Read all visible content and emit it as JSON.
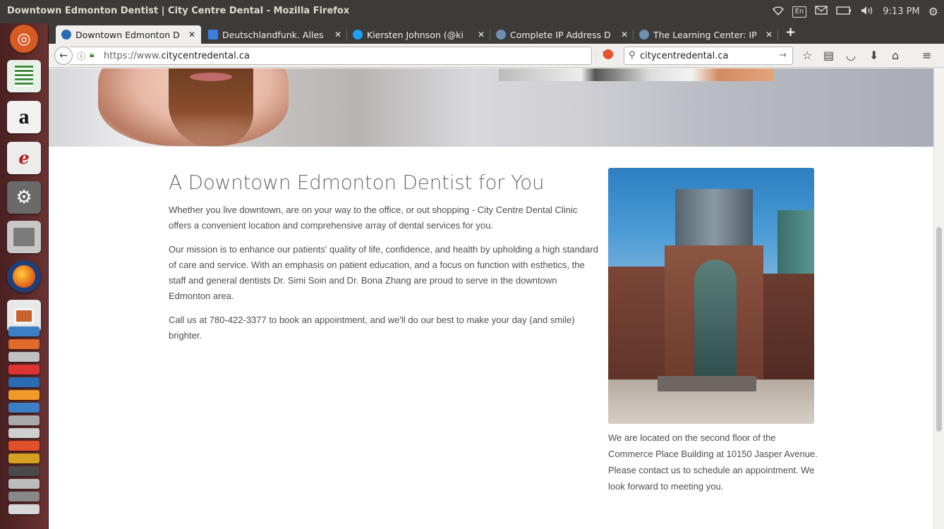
{
  "window": {
    "title": "Downtown Edmonton Dentist | City Centre Dental - Mozilla Firefox"
  },
  "indicators": {
    "keyboard": "En",
    "time": "9:13 PM"
  },
  "tabs": [
    {
      "label": "Downtown Edmonton D",
      "icon": "city-centre-dental-favicon",
      "active": true
    },
    {
      "label": "Deutschlandfunk. Alles",
      "icon": "document-favicon",
      "active": false
    },
    {
      "label": "Kiersten Johnson (@ki",
      "icon": "twitter-favicon",
      "active": false
    },
    {
      "label": "Complete IP Address D",
      "icon": "globe-favicon",
      "active": false
    },
    {
      "label": "The Learning Center: IP",
      "icon": "globe-favicon",
      "active": false
    }
  ],
  "navbar": {
    "url_prefix": "https://www.",
    "url_domain": "citycentredental.ca",
    "search_query": "citycentredental.ca"
  },
  "content": {
    "heading": "A Downtown Edmonton Dentist for You",
    "p1": "Whether you live downtown, are on your way to the office, or out shopping - City Centre Dental Clinic offers a convenient location and comprehensive array of dental services for you.",
    "p2": "Our mission is to enhance our patients' quality of life, confidence, and health by upholding a high standard of care and service. With an emphasis on patient education, and a focus on function with esthetics, the staff and general dentists Dr. Simi Soin and Dr. Bona Zhang are proud to serve in the downtown Edmonton area.",
    "p3": "Call us at 780-422-3377 to book an appointment, and we'll do our best to make your day (and smile) brighter.",
    "caption": "We are located on the second floor of the Commerce Place Building at 10150 Jasper Avenue. Please contact us to schedule an appointment. We look forward to meeting you."
  },
  "launcher": [
    {
      "name": "ubuntu-dash-icon",
      "color": "#e05a2b"
    },
    {
      "name": "spreadsheet-icon",
      "color": "#3e8e3e"
    },
    {
      "name": "amazon-icon",
      "color": "#e8e8e8"
    },
    {
      "name": "pdf-reader-icon",
      "color": "#d8d8d8"
    },
    {
      "name": "system-settings-icon",
      "color": "#8a3030"
    },
    {
      "name": "file-archive-icon",
      "color": "#b8b8b8"
    },
    {
      "name": "firefox-icon",
      "color": "#e66a1c"
    },
    {
      "name": "presentation-icon",
      "color": "#d8d8d8"
    }
  ],
  "colors": {
    "accent_tab": "#f0efee",
    "panel": "#3c3b37",
    "launcher": "#5b2a2a",
    "body_text": "#4d4d4d",
    "heading_text": "#6a6a6a"
  }
}
